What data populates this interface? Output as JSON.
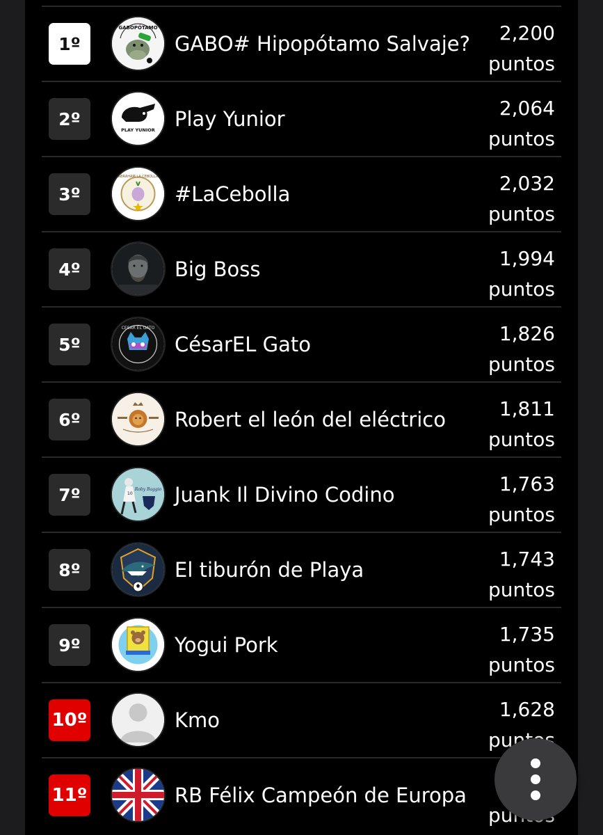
{
  "ranking": [
    {
      "rank": "1º",
      "name": "GABO# Hipopótamo Salvaje?",
      "points": "2,200",
      "unit": "puntos",
      "avatar": "hippo-avatar-icon",
      "avatar_text": "GABOPÓTAMO"
    },
    {
      "rank": "2º",
      "name": "Play Yunior",
      "points": "2,064",
      "unit": "puntos",
      "avatar": "playboy-bunny-avatar-icon",
      "avatar_text": "PLAY YUNIOR"
    },
    {
      "rank": "3º",
      "name": "#LaCebolla",
      "points": "2,032",
      "unit": "puntos",
      "avatar": "onion-crest-avatar-icon",
      "avatar_text": "ABRAHAM LA CEBOLLA"
    },
    {
      "rank": "4º",
      "name": "Big Boss",
      "points": "1,994",
      "unit": "puntos",
      "avatar": "warrior-portrait-avatar-icon"
    },
    {
      "rank": "5º",
      "name": "CésarEL Gato",
      "points": "1,826",
      "unit": "puntos",
      "avatar": "cat-mask-avatar-icon",
      "avatar_text": "CESAR EL GATO"
    },
    {
      "rank": "6º",
      "name": "Robert el león del eléctrico",
      "points": "1,811",
      "unit": "puntos",
      "avatar": "lion-crest-avatar-icon"
    },
    {
      "rank": "7º",
      "name": "Juank Il Divino Codino",
      "points": "1,763",
      "unit": "puntos",
      "avatar": "footballer-avatar-icon",
      "avatar_text": "Roby Baggio"
    },
    {
      "rank": "8º",
      "name": "El tiburón de Playa",
      "points": "1,743",
      "unit": "puntos",
      "avatar": "shark-avatar-icon"
    },
    {
      "rank": "9º",
      "name": "Yogui Pork",
      "points": "1,735",
      "unit": "puntos",
      "avatar": "bear-badge-avatar-icon"
    },
    {
      "rank": "10º",
      "name": "Kmo",
      "points": "1,628",
      "unit": "puntos",
      "avatar": "default-user-avatar-icon"
    },
    {
      "rank": "11º",
      "name": "RB Félix Campeón de Europa",
      "points": "",
      "unit": "puntos",
      "avatar": "union-jack-avatar-icon"
    }
  ],
  "colors": {
    "background": "#000000",
    "outer": "#1c1c1e",
    "rank_default": "#2b2b2b",
    "rank_first": "#ffffff",
    "rank_relegation": "#e00000",
    "fab": "#3a3a3c"
  },
  "fab": {
    "icon": "more-vertical-icon"
  }
}
